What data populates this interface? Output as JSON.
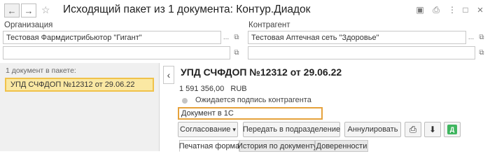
{
  "window": {
    "title": "Исходящий пакет из 1 документа: Контур.Диадок",
    "back_icon": "←",
    "forward_icon": "→",
    "star_icon": "☆"
  },
  "top_icons": {
    "save": "▣",
    "print": "⎙",
    "more": "⋮",
    "maximize": "□",
    "close": "×"
  },
  "organization": {
    "label": "Организация",
    "value": "Тестовая Фармдистрибьютор \"Гигант\"",
    "second_value": ""
  },
  "counterparty": {
    "label": "Контрагент",
    "value": "Тестовая Аптечная сеть \"Здоровье\"",
    "second_value": ""
  },
  "field_buttons": {
    "select": "...",
    "open": "⧉"
  },
  "package": {
    "header": "1 документ в пакете:",
    "items": [
      "УПД СЧФДОП №12312 от 29.06.22"
    ],
    "collapse_icon": "‹"
  },
  "document": {
    "title": "УПД СЧФДОП №12312 от 29.06.22",
    "amount": "1 591 356,00",
    "currency": "RUB",
    "status": "Ожидается подпись контрагента",
    "comment": "Документ в 1С"
  },
  "actions": {
    "approval": "Согласование",
    "approval_arrow": "▾",
    "transfer": "Передать в подразделение",
    "cancel": "Аннулировать",
    "print_icon": "⎙",
    "download_icon": "⬇",
    "diadoc_icon": "Д"
  },
  "tabs": [
    {
      "label": "Печатная форма"
    },
    {
      "label": "История по документу"
    },
    {
      "label": "Доверенности"
    }
  ],
  "colors": {
    "selection_fill": "#fae8a3",
    "selection_border": "#f0c24a",
    "comment_border": "#e6a23c",
    "diadoc_green": "#3fb55f"
  }
}
